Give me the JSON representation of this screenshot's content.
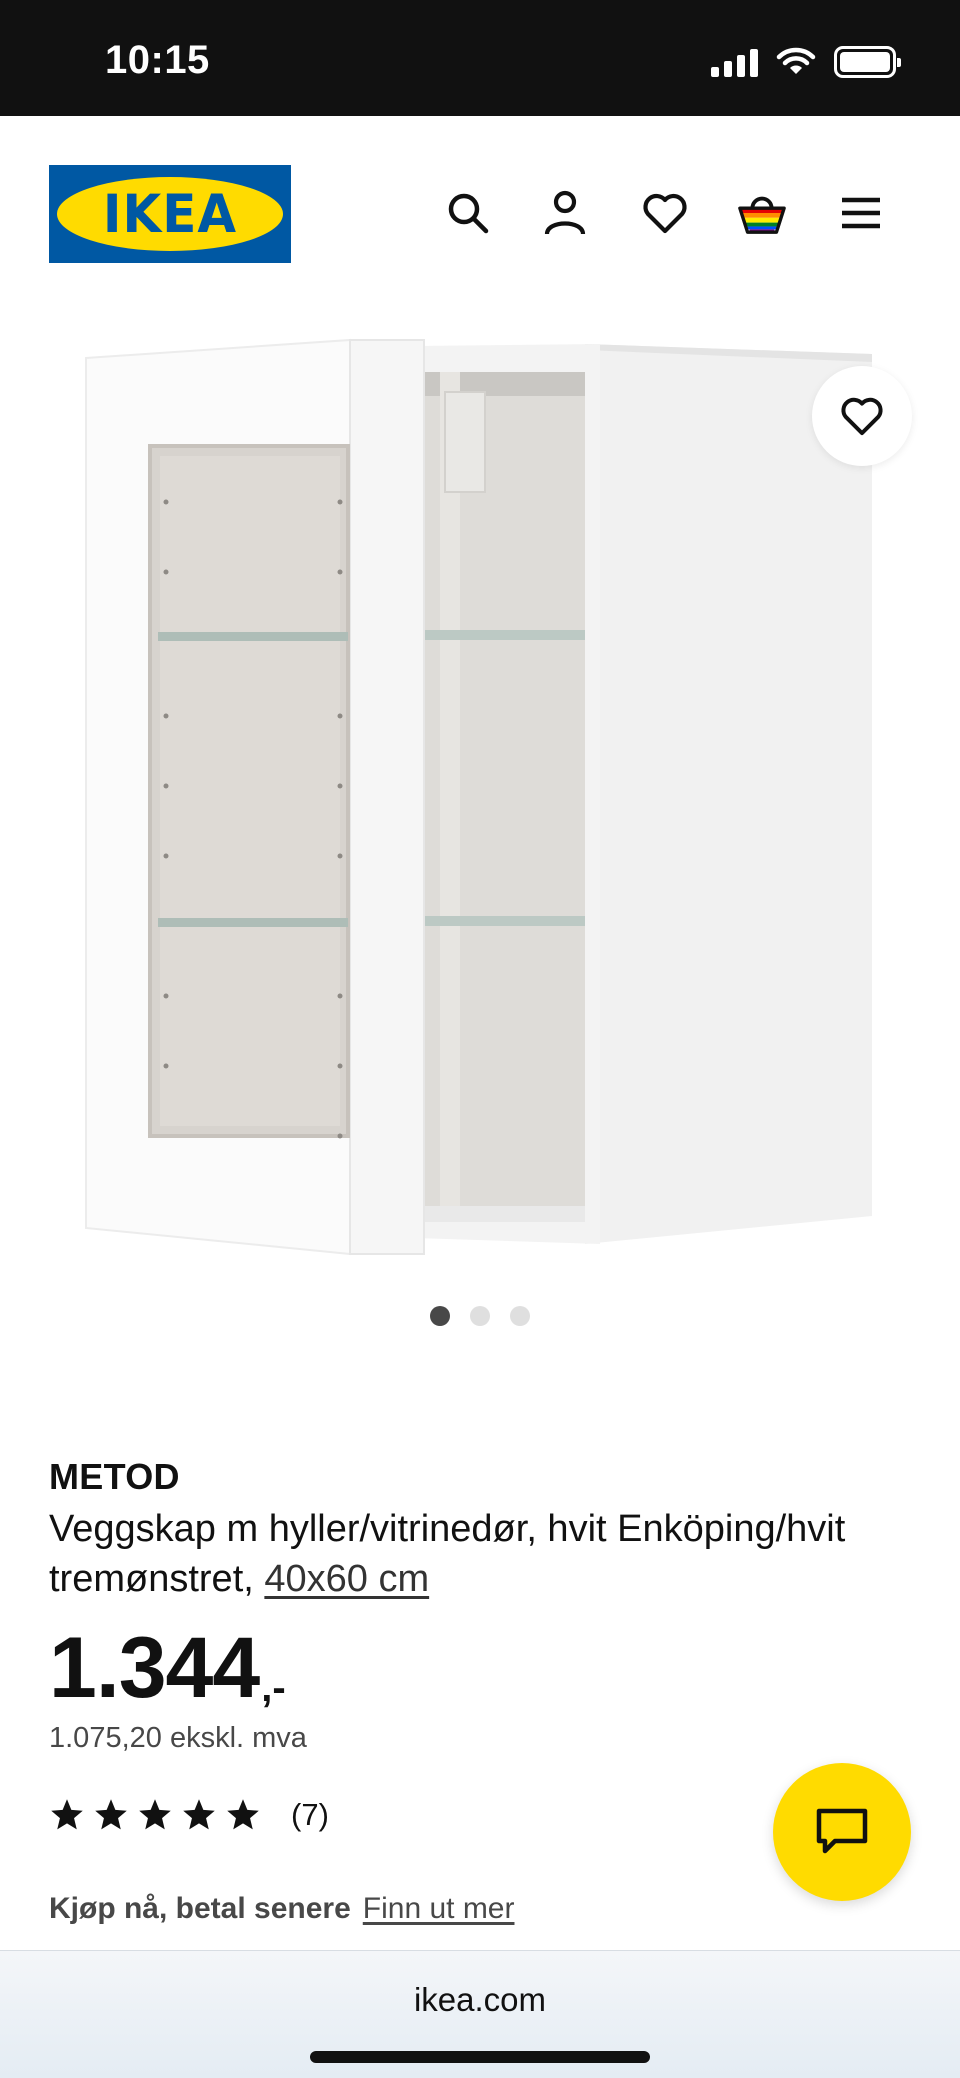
{
  "status_bar": {
    "time": "10:15"
  },
  "header": {
    "logo_text": "IKEA",
    "icons": [
      "search-icon",
      "account-icon",
      "heart-icon",
      "basket-icon",
      "menu-icon"
    ]
  },
  "gallery": {
    "image_count": 3,
    "active_index": 0
  },
  "product": {
    "name": "METOD",
    "description": "Veggskap m hyller/vitrinedør, hvit Enköping/hvit tremønstret,",
    "size": "40x60 cm",
    "price": "1.344",
    "price_suffix": ",-",
    "price_ex_vat": "1.075,20 ekskl. mva",
    "rating_stars": 5,
    "rating_count": "(7)"
  },
  "bnpl": {
    "title": "Kjøp nå, betal senere",
    "link": "Finn ut mer"
  },
  "browser": {
    "url": "ikea.com"
  },
  "colors": {
    "brand_blue": "#0058a3",
    "brand_yellow": "#ffdb00",
    "text": "#111111"
  }
}
